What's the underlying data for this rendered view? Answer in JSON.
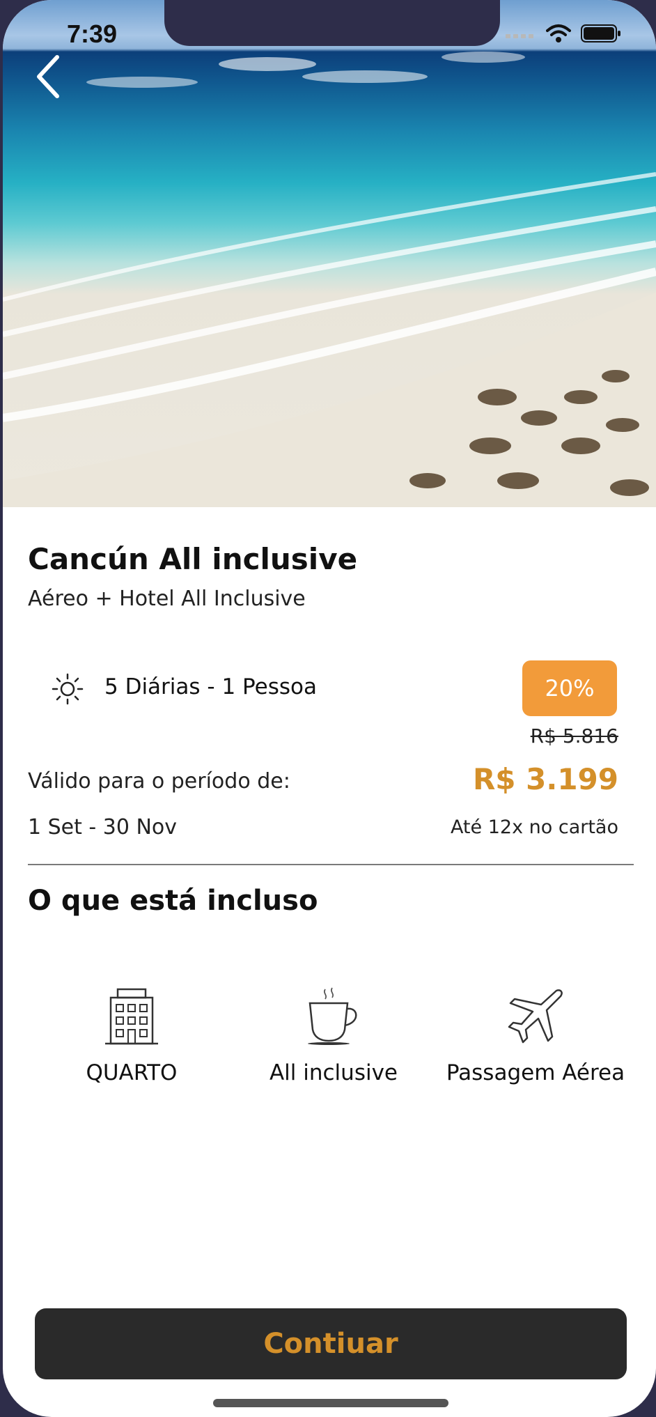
{
  "status_bar": {
    "time": "7:39",
    "icons": [
      "signal-icon",
      "wifi-icon",
      "battery-icon"
    ]
  },
  "hero": {
    "image": "beach-photo",
    "back_icon": "chevron-left-icon"
  },
  "package": {
    "title": "Cancún All inclusive",
    "subtitle": "Aéreo + Hotel All Inclusive",
    "nights_label": "5 Diárias - 1 Pessoa",
    "nights_icon": "sun-icon",
    "discount": "20%",
    "old_price": "R$ 5.816",
    "new_price": "R$ 3.199",
    "valid_label": "Válido para o período de:",
    "valid_dates": "1 Set - 30 Nov",
    "installments": "Até 12x no cartão"
  },
  "included": {
    "title": "O que está incluso",
    "items": [
      {
        "label": "QUARTO",
        "icon": "hotel-building-icon"
      },
      {
        "label": "All inclusive",
        "icon": "coffee-cup-icon"
      },
      {
        "label": "Passagem Aérea",
        "icon": "airplane-icon"
      }
    ]
  },
  "cta": {
    "label": "Contiuar"
  },
  "colors": {
    "accent": "#d4902a",
    "badge": "#f29b3a",
    "button_bg": "#2a2a2a",
    "background": "#ffffff"
  }
}
